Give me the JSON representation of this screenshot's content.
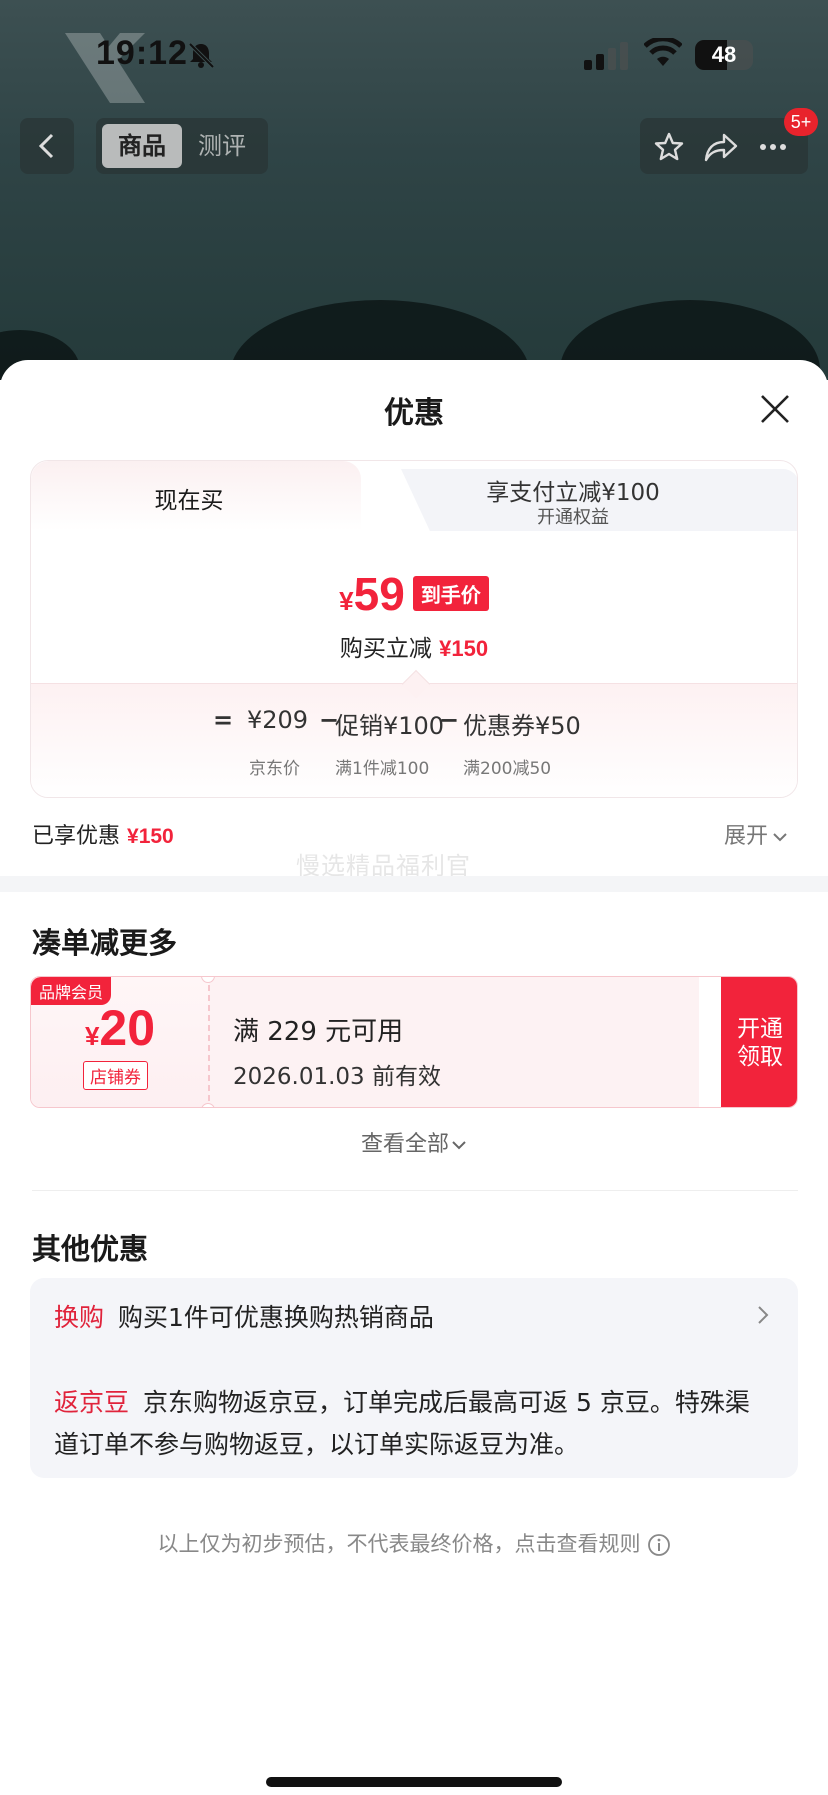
{
  "status_bar": {
    "time": "19:12",
    "battery": "48"
  },
  "nav": {
    "tabs": [
      "商品",
      "测评"
    ],
    "badge": "5+"
  },
  "sheet": {
    "title": "优惠"
  },
  "price_card": {
    "tab_now": "现在买",
    "tab_pay_title": "享支付立减¥100",
    "tab_pay_sub": "开通权益",
    "final_currency": "¥",
    "final_price": "59",
    "final_tag": "到手价",
    "instant_cut_label": "购买立减",
    "instant_cut_value": "¥150",
    "breakdown": {
      "equals": "=",
      "jd_price": "¥209",
      "minus1": "−",
      "promo": "促销¥100",
      "minus2": "−",
      "coupon": "优惠券¥50",
      "jd_price_label": "京东价",
      "promo_label": "满1件减100",
      "coupon_label": "满200减50"
    }
  },
  "enjoyed": {
    "label": "已享优惠",
    "value": "¥150",
    "expand": "展开"
  },
  "watermark": "慢选精品福利官",
  "more_section": {
    "title": "凑单减更多",
    "coupon": {
      "member_tag": "品牌会员",
      "currency": "¥",
      "amount": "20",
      "type": "店铺券",
      "condition": "满 229 元可用",
      "expiry": "2026.01.03 前有效",
      "button": "开通\n领取"
    },
    "view_all": "查看全部"
  },
  "other_section": {
    "title": "其他优惠",
    "row1_label": "换购",
    "row1_text": "购买1件可优惠换购热销商品",
    "row2_label": "返京豆",
    "row2_text": "京东购物返京豆，订单完成后最高可返 5 京豆。特殊渠道订单不参与购物返豆，以订单实际返豆为准。"
  },
  "footer_note": "以上仅为初步预估，不代表最终价格，点击查看规则",
  "colors": {
    "accent_red": "#f2233b",
    "text_dark": "#1a1a1a",
    "muted": "#888888"
  }
}
